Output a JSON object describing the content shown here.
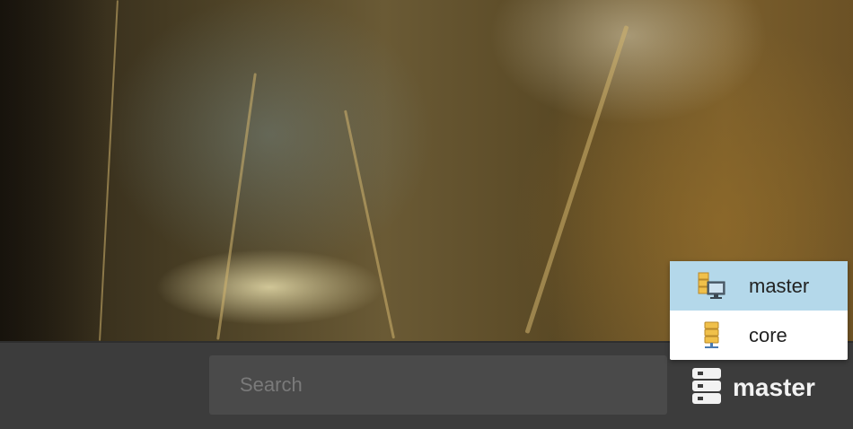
{
  "search": {
    "placeholder": "Search"
  },
  "server_button": {
    "label": "master",
    "icon": "server-stack-icon"
  },
  "server_menu": {
    "items": [
      {
        "label": "master",
        "icon": "server-monitor-icon",
        "selected": true
      },
      {
        "label": "core",
        "icon": "server-tower-icon",
        "selected": false
      }
    ]
  },
  "colors": {
    "bottom_bar": "#3c3c3c",
    "search_bg": "#4a4a4a",
    "menu_selected": "#b4d8ea",
    "server_icon_yellow": "#f0c04a"
  }
}
